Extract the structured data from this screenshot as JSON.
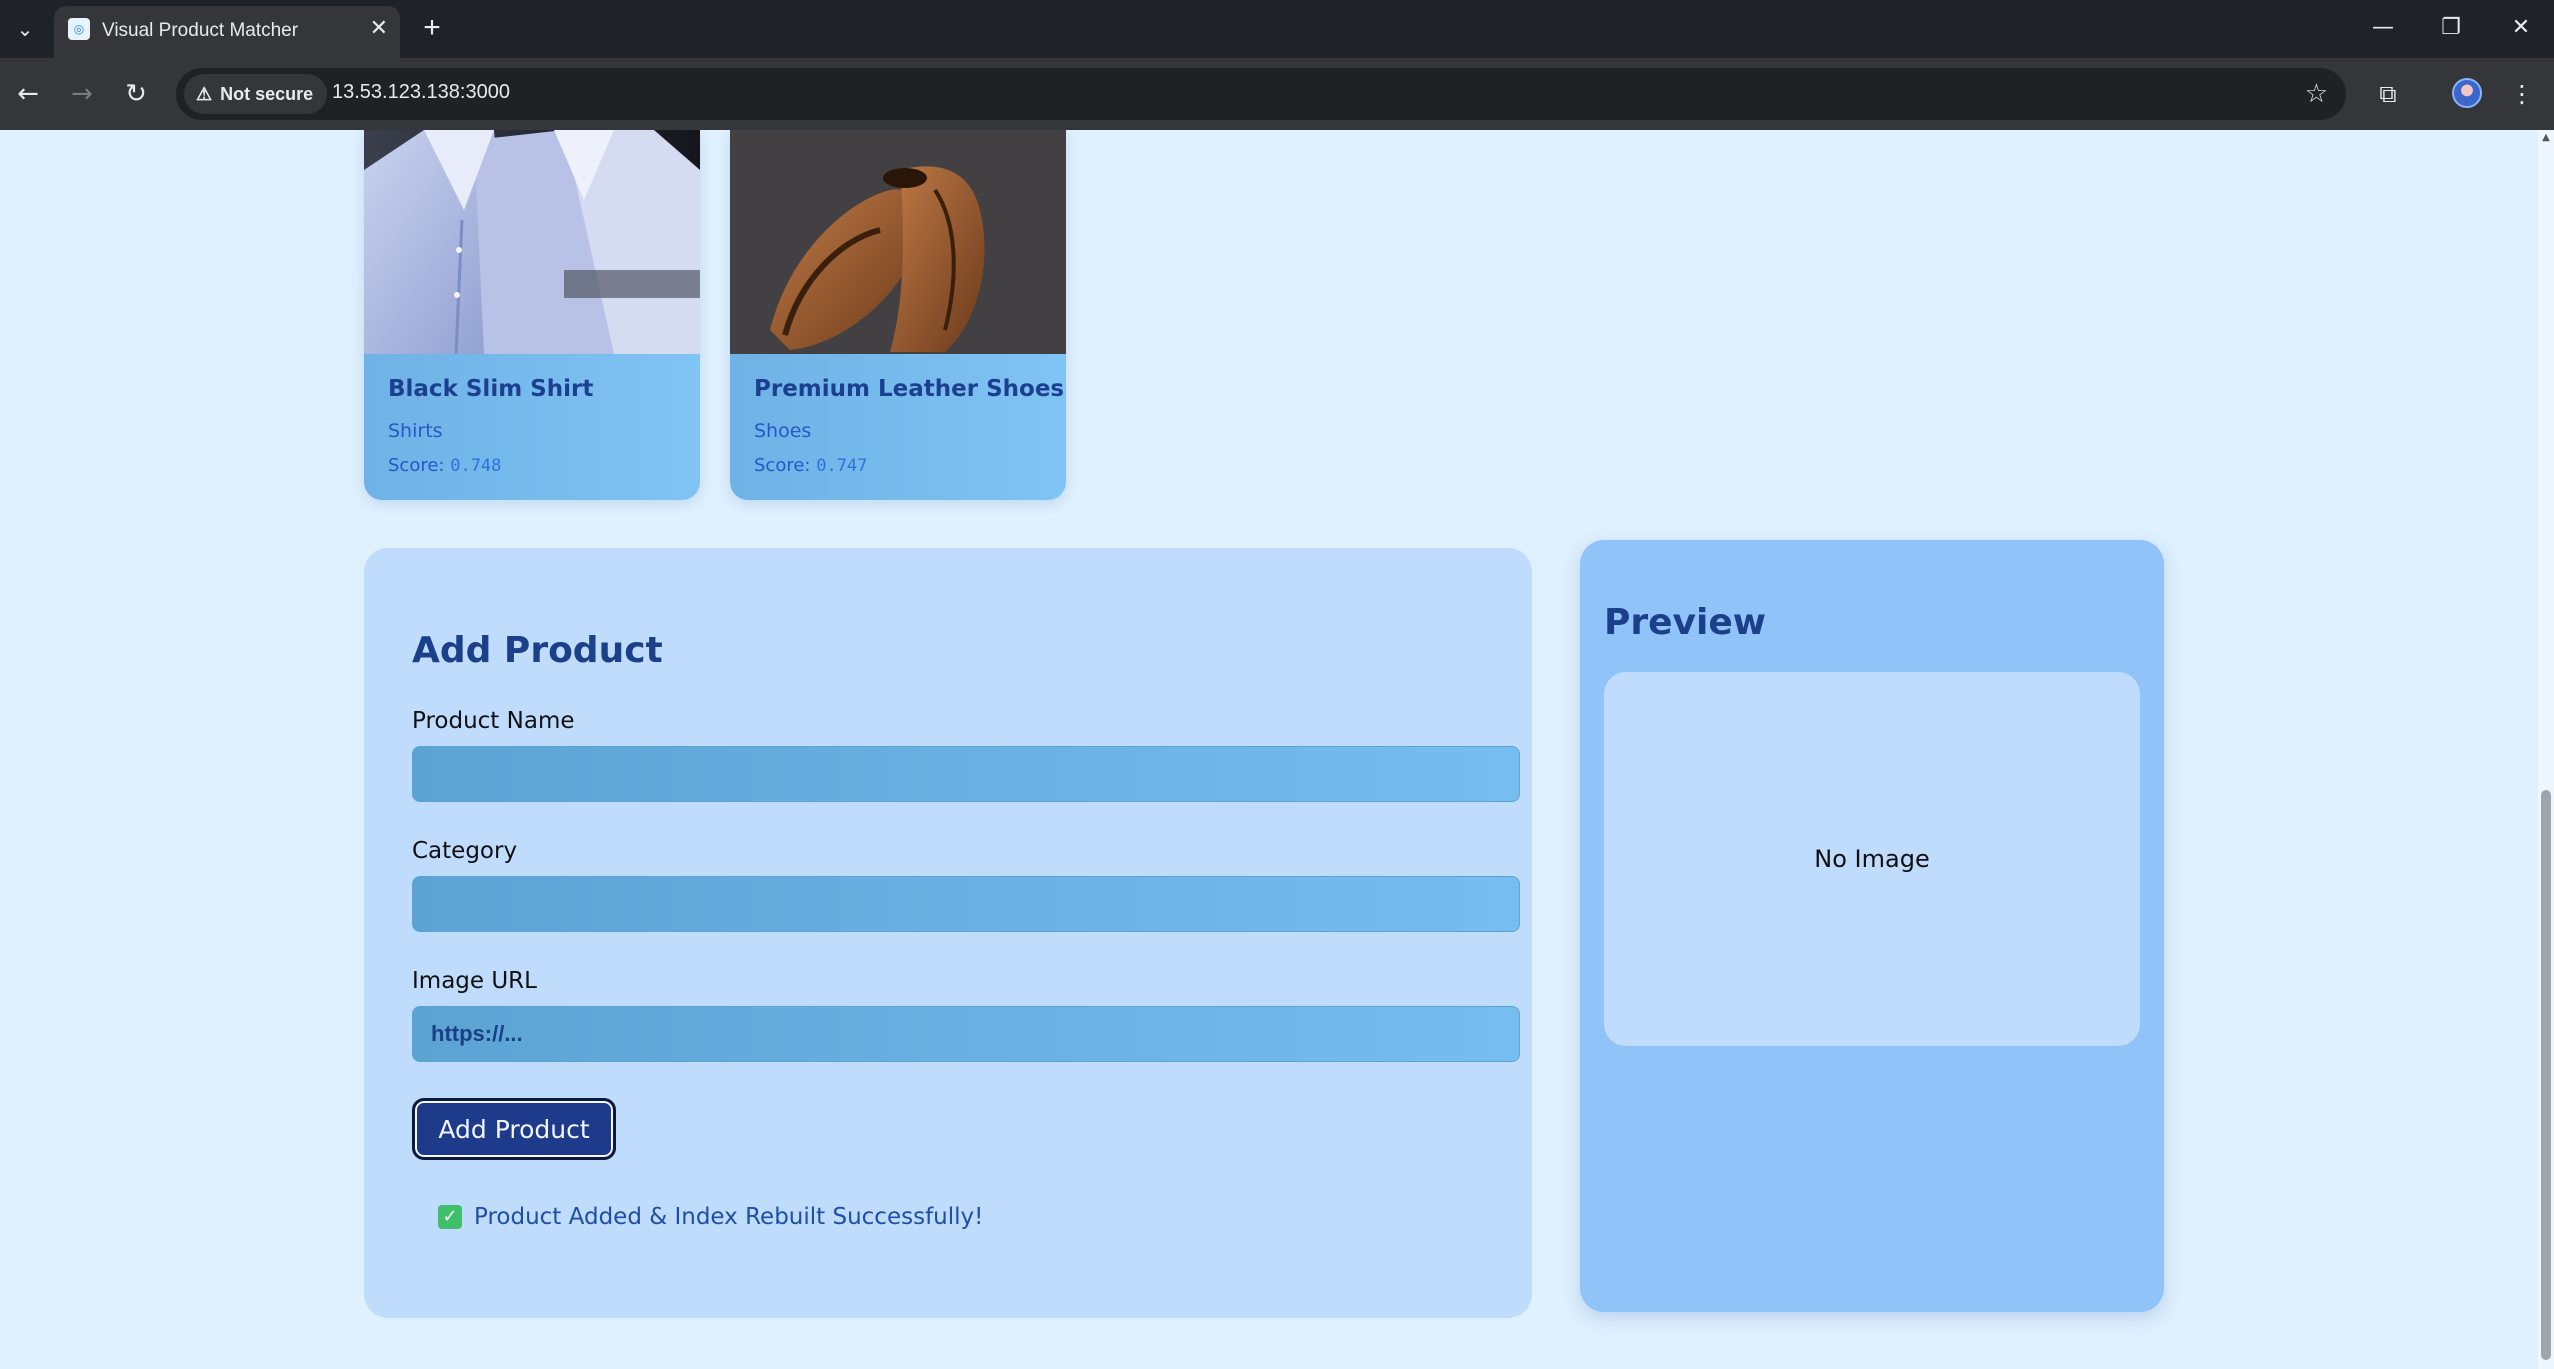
{
  "browser": {
    "tab_title": "Visual Product Matcher",
    "tab_close": "✕",
    "new_tab": "+",
    "security_label": "Not secure",
    "url": "13.53.123.138:3000"
  },
  "icons": {
    "tab_list": "⌄",
    "back": "←",
    "forward": "→",
    "reload": "↻",
    "warning": "⚠",
    "star": "☆",
    "extensions": "⧉",
    "menu": "⋮",
    "minimize": "—",
    "restore": "❐",
    "close": "✕",
    "check": "✓"
  },
  "results": [
    {
      "name": "Black Slim Shirt",
      "category": "Shirts",
      "score_label": "Score:",
      "score": "0.748"
    },
    {
      "name": "Premium Leather Shoes",
      "category": "Shoes",
      "score_label": "Score:",
      "score": "0.747"
    }
  ],
  "add_product": {
    "title": "Add Product",
    "name_label": "Product Name",
    "name_value": "",
    "category_label": "Category",
    "category_value": "",
    "url_label": "Image URL",
    "url_placeholder": "https://...",
    "button_label": "Add Product",
    "success_message": "Product Added & Index Rebuilt Successfully!"
  },
  "preview": {
    "title": "Preview",
    "empty_text": "No Image"
  },
  "colors": {
    "page_bg": "#dff0fe",
    "accent": "#1e3a8a",
    "success": "#3fbf6a"
  }
}
